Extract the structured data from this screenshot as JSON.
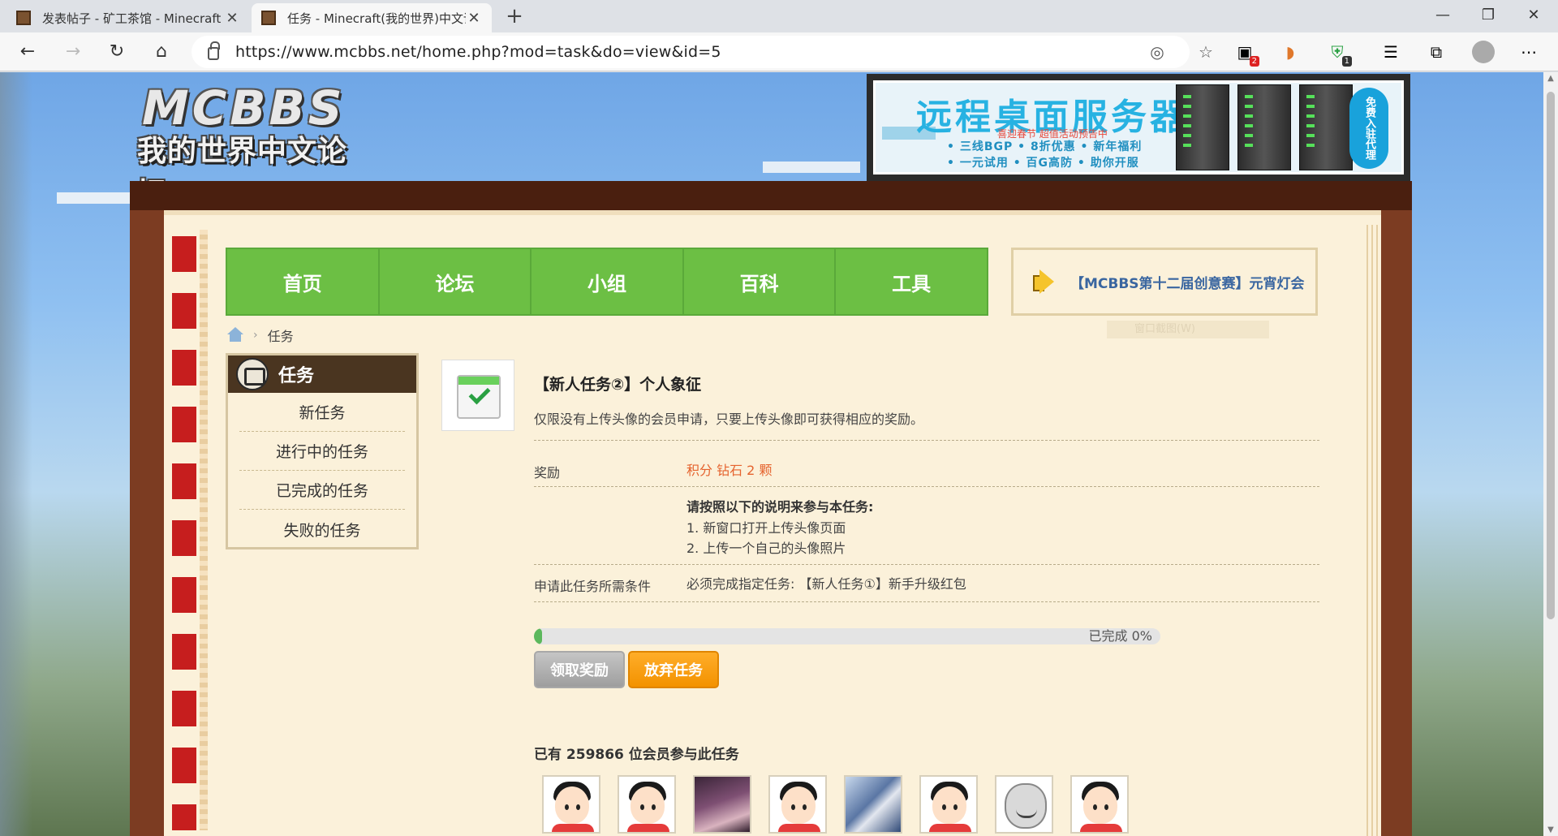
{
  "browser": {
    "tabs": [
      {
        "title": "发表帖子 - 矿工茶馆 - Minecraft",
        "close": "✕"
      },
      {
        "title": "任务 - Minecraft(我的世界)中文论",
        "close": "✕"
      }
    ],
    "new_tab": "+",
    "window_controls": {
      "minimize": "—",
      "maximize": "❐",
      "close": "✕"
    },
    "nav": {
      "back": "←",
      "forward": "→",
      "reload": "↻",
      "home": "⌂"
    },
    "url": "https://www.mcbbs.net/home.php?mod=task&do=view&id=5",
    "extension_badges": [
      "2",
      "1"
    ],
    "menu": "⋯"
  },
  "site": {
    "logo_text": "MCBBS",
    "logo_subtitle": "我的世界中文论坛",
    "ad": {
      "title": "远程桌面服务器",
      "red_text": "喜迎春节 超值活动预告中",
      "line1": "• 三线BGP • 8折优惠 • 新年福利",
      "line2": "• 一元试用 • 百G高防 • 助你开服",
      "pill": "免费入驻代理"
    },
    "nav": [
      "首页",
      "论坛",
      "小组",
      "百科",
      "工具"
    ],
    "announcement": "【MCBBS第十二届创意赛】元宵灯会",
    "ghost_text": "窗口截图(W)"
  },
  "breadcrumb": {
    "current": "任务"
  },
  "sidebar": {
    "title": "任务",
    "items": [
      "新任务",
      "进行中的任务",
      "已完成的任务",
      "失败的任务"
    ]
  },
  "task": {
    "title": "【新人任务②】个人象征",
    "description": "仅限没有上传头像的会员申请，只要上传头像即可获得相应的奖励。",
    "reward_label": "奖励",
    "reward_value": "积分 钻石 2 颗",
    "instructions_title": "请按照以下的说明来参与本任务:",
    "instructions": [
      "1. 新窗口打开上传头像页面",
      "2. 上传一个自己的头像照片"
    ],
    "condition_label": "申请此任务所需条件",
    "condition_value": "必须完成指定任务: 【新人任务①】新手升级红包",
    "progress_text": "已完成 0%",
    "progress": 0,
    "buttons": {
      "claim": "领取奖励",
      "abandon": "放弃任务"
    },
    "members_text": "已有 259866 位会员参与此任务"
  }
}
